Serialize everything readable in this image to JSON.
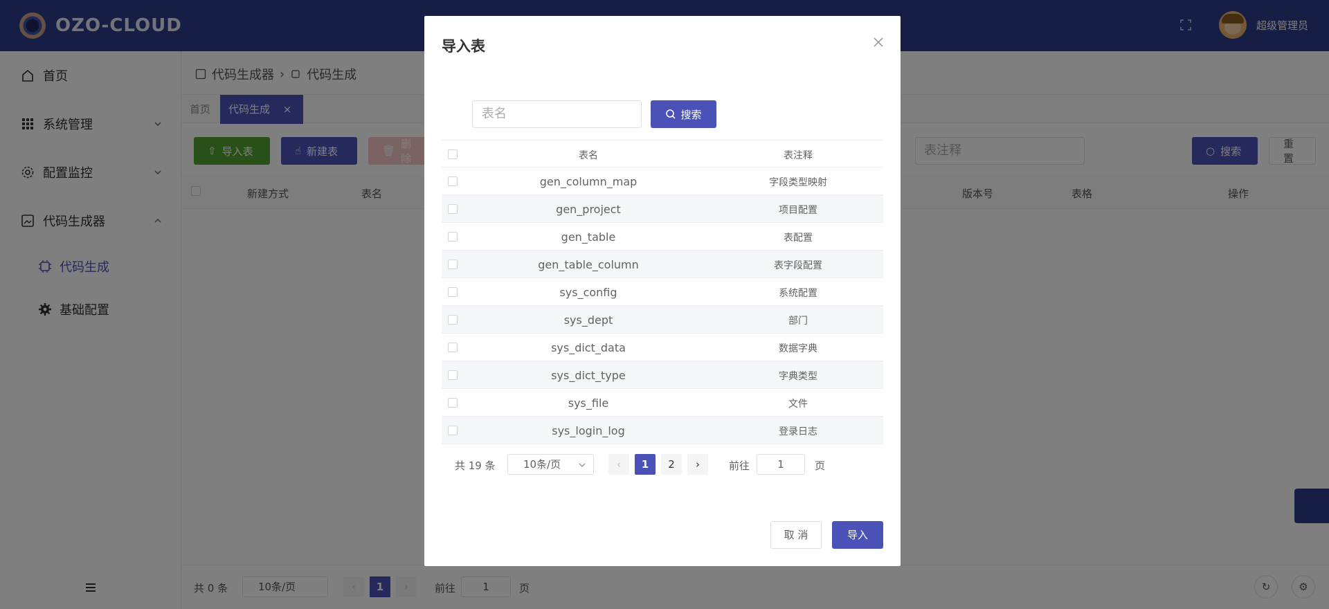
{
  "header": {
    "brand": "OZO-CLOUD",
    "user_name": "超级管理员"
  },
  "sidebar": {
    "items": [
      {
        "label": "首页",
        "icon": "home-icon"
      },
      {
        "label": "系统管理",
        "icon": "grid-icon"
      },
      {
        "label": "配置监控",
        "icon": "gear-icon"
      },
      {
        "label": "代码生成器",
        "icon": "image-icon"
      },
      {
        "label": "代码生成",
        "icon": "chip-icon"
      },
      {
        "label": "基础配置",
        "icon": "cog-icon"
      }
    ]
  },
  "breadcrumb": [
    "代码生成器",
    "代码生成"
  ],
  "tabs": [
    {
      "label": "首页"
    },
    {
      "label": "代码生成"
    }
  ],
  "toolbar": {
    "import": "导入表",
    "create": "新建表",
    "delete": "删除",
    "table_comment_placeholder": "表注释",
    "search": "搜索",
    "reset": "重置"
  },
  "grid": {
    "headers": [
      "新建方式",
      "表名",
      "版本号",
      "表格",
      "操作"
    ]
  },
  "bottom_pager": {
    "total": "共 0 条",
    "size": "10条/页",
    "page": "1",
    "goto": "前往",
    "goto_value": "1",
    "unit": "页"
  },
  "dialog": {
    "title": "导入表",
    "search_placeholder": "表名",
    "search_button": "搜索",
    "columns": [
      "表名",
      "表注释"
    ],
    "rows": [
      {
        "name": "gen_column_map",
        "comment": "字段类型映射"
      },
      {
        "name": "gen_project",
        "comment": "项目配置"
      },
      {
        "name": "gen_table",
        "comment": "表配置"
      },
      {
        "name": "gen_table_column",
        "comment": "表字段配置"
      },
      {
        "name": "sys_config",
        "comment": "系统配置"
      },
      {
        "name": "sys_dept",
        "comment": "部门"
      },
      {
        "name": "sys_dict_data",
        "comment": "数据字典"
      },
      {
        "name": "sys_dict_type",
        "comment": "字典类型"
      },
      {
        "name": "sys_file",
        "comment": "文件"
      },
      {
        "name": "sys_login_log",
        "comment": "登录日志"
      }
    ],
    "pager": {
      "total": "共 19 条",
      "size": "10条/页",
      "pages": [
        "1",
        "2"
      ],
      "goto": "前往",
      "goto_value": "1",
      "unit": "页"
    },
    "cancel": "取 消",
    "confirm": "导入"
  },
  "colors": {
    "primary": "#4a52b8",
    "header": "#2f3c8c",
    "success": "#52a032"
  }
}
